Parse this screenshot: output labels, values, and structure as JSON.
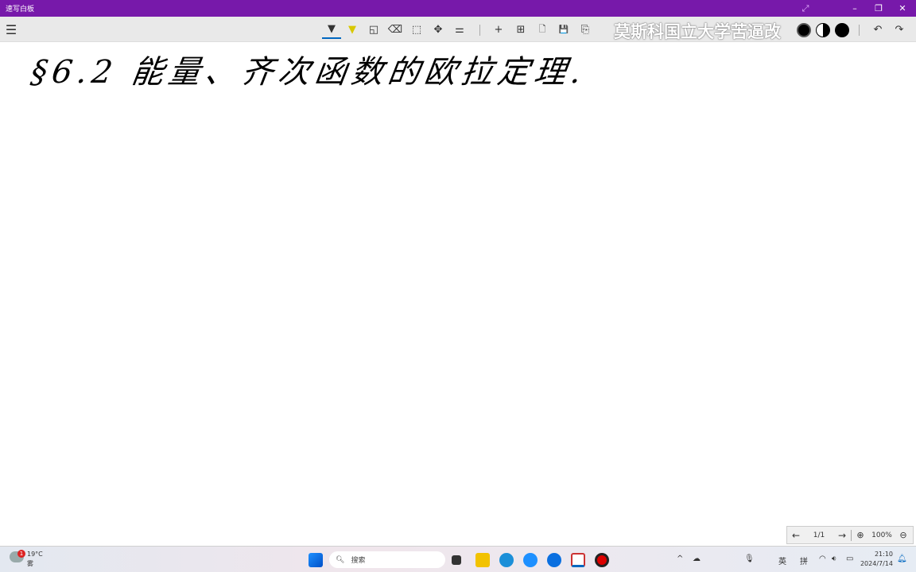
{
  "window": {
    "title": "速写白板"
  },
  "toolbar": {
    "tools": [
      {
        "name": "pen-tool",
        "glyph": "▼"
      },
      {
        "name": "highlighter-tool",
        "glyph": "▼"
      },
      {
        "name": "shape-tool",
        "glyph": "◱"
      },
      {
        "name": "eraser-tool",
        "glyph": "⌫"
      },
      {
        "name": "select-tool",
        "glyph": "⬚"
      },
      {
        "name": "pan-tool",
        "glyph": "✥"
      },
      {
        "name": "settings-tool",
        "glyph": "⚌"
      }
    ],
    "actions": [
      {
        "name": "add-page",
        "glyph": "+"
      },
      {
        "name": "grid",
        "glyph": "⊞"
      },
      {
        "name": "new-file",
        "glyph": "🗋"
      },
      {
        "name": "save",
        "glyph": "💾"
      },
      {
        "name": "export",
        "glyph": "⎘"
      }
    ],
    "undo": "↶",
    "redo": "↷"
  },
  "watermark": "莫斯科国立大学苦逼改",
  "canvas": {
    "handwriting": "§6.2 能量、齐次函数的欧拉定理."
  },
  "nav": {
    "prev": "←",
    "page": "1/1",
    "next": "→",
    "zoom_in": "⊕",
    "zoom": "100%",
    "zoom_out": "⊖"
  },
  "taskbar": {
    "weather": {
      "temp": "19°C",
      "cond": "雾",
      "badge": "1"
    },
    "search_placeholder": "搜索",
    "tray": {
      "ime1": "英",
      "ime2": "拼",
      "time": "21:10",
      "date": "2024/7/14"
    }
  },
  "colors": {
    "titlebar": "#7719aa",
    "active_underline": "#0067c0"
  }
}
